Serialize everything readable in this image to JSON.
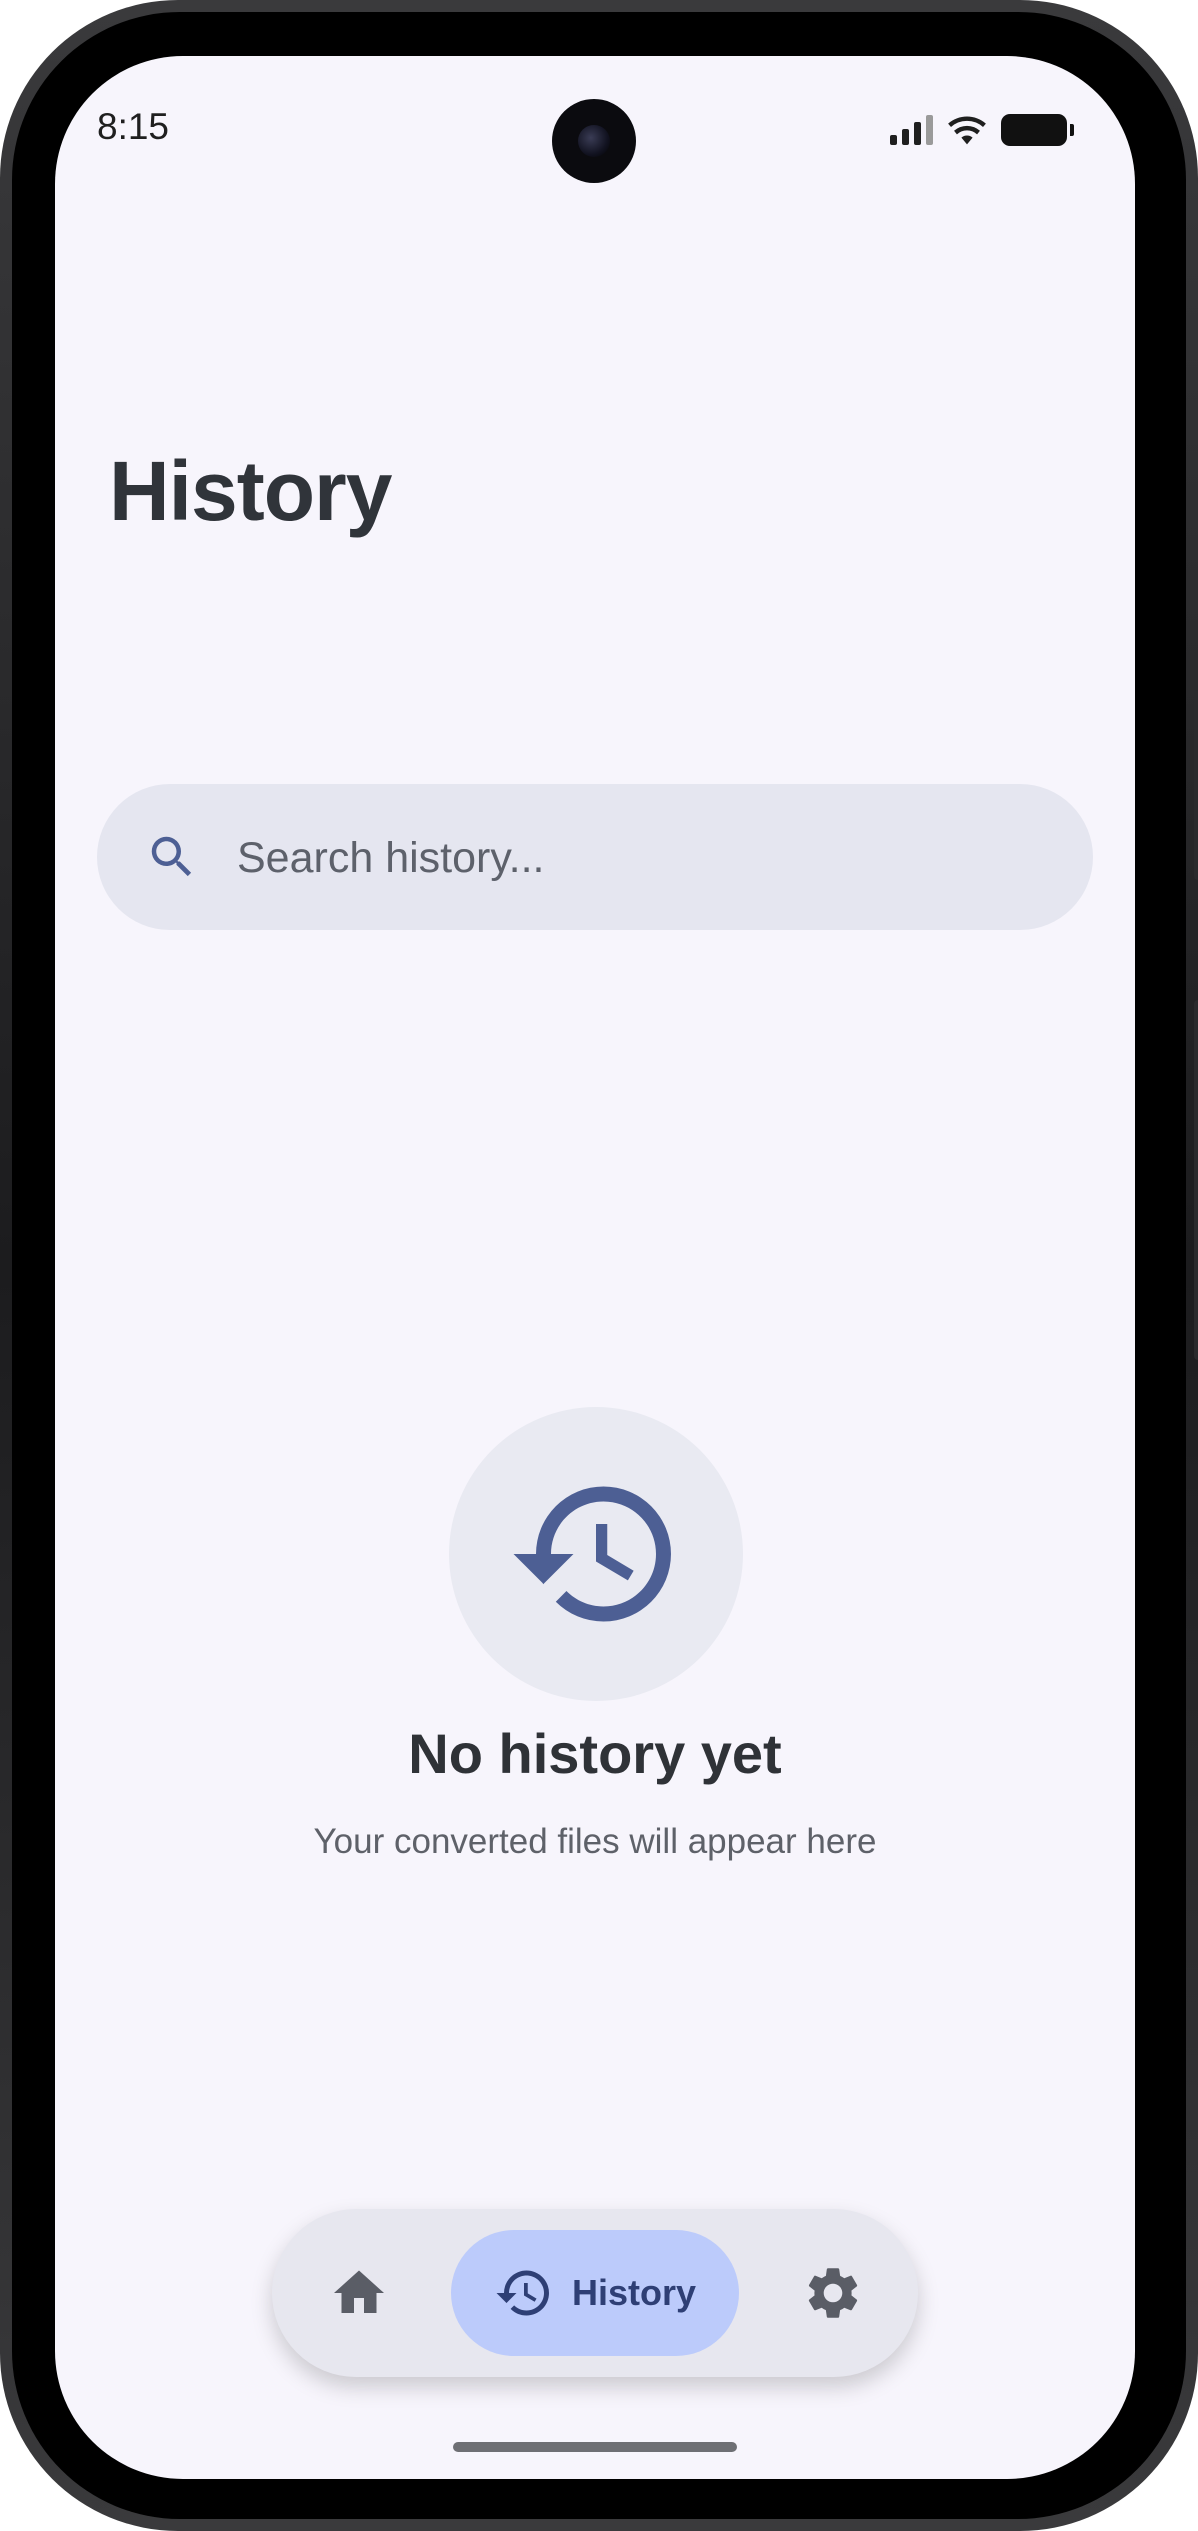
{
  "status_bar": {
    "time": "8:15",
    "icons": [
      "signal-icon",
      "wifi-icon",
      "battery-icon"
    ]
  },
  "header": {
    "title": "History"
  },
  "search": {
    "placeholder": "Search history...",
    "value": "",
    "icon": "search-icon"
  },
  "empty_state": {
    "icon": "history-icon",
    "title": "No history yet",
    "subtitle": "Your converted files will appear here"
  },
  "bottom_nav": {
    "items": [
      {
        "icon": "home-icon",
        "label": "",
        "active": false
      },
      {
        "icon": "history-icon",
        "label": "History",
        "active": true
      },
      {
        "icon": "gear-icon",
        "label": "",
        "active": false
      }
    ]
  },
  "colors": {
    "background": "#f7f5fc",
    "title_text": "#30343a",
    "accent_icon": "#4d5f94",
    "active_pill": "#bccbfb",
    "active_text": "#2e3f75",
    "search_bg": "#e5e6f0",
    "nav_bg": "#e7e7ef"
  }
}
